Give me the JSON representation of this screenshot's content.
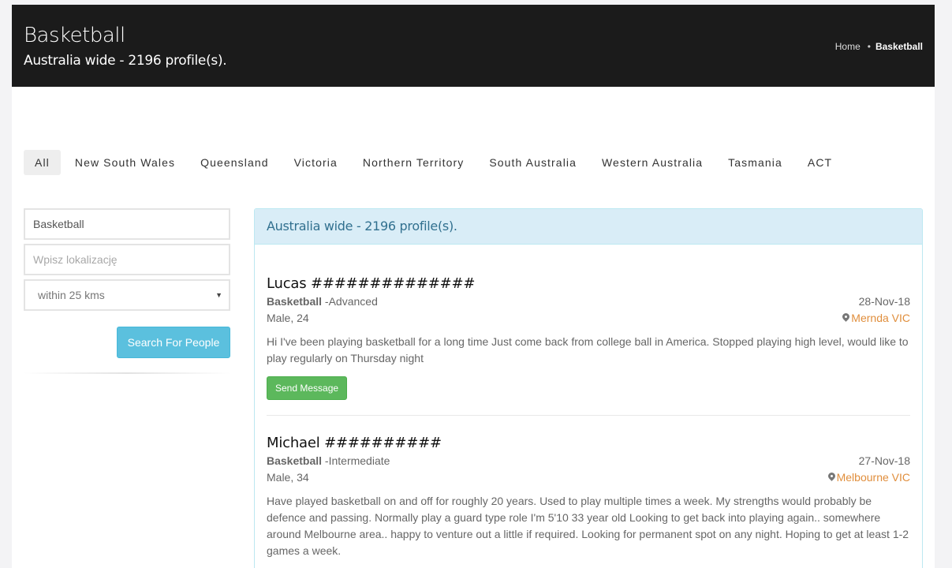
{
  "header": {
    "title": "Basketball",
    "subtitle": "Australia wide - 2196 profile(s).",
    "breadcrumb": {
      "home": "Home",
      "separator": "•",
      "current": "Basketball"
    }
  },
  "tabs": [
    "All",
    "New South Wales",
    "Queensland",
    "Victoria",
    "Northern Territory",
    "South Australia",
    "Western Australia",
    "Tasmania",
    "ACT"
  ],
  "search": {
    "activity_value": "Basketball",
    "location_placeholder": "Wpisz lokalizację",
    "distance_selected": "within 25 kms",
    "button_label": "Search For People"
  },
  "results": {
    "heading": "Australia wide - 2196 profile(s).",
    "profiles": [
      {
        "name": "Lucas ##############",
        "sport": "Basketball",
        "level": " -Advanced",
        "gender_age": "Male, 24",
        "date": "28-Nov-18",
        "location": "Mernda VIC",
        "description": "Hi I've been playing basketball for a long time Just come back from college ball in America. Stopped playing high level, would like to play regularly on Thursday night",
        "button": "Send Message"
      },
      {
        "name": "Michael ##########",
        "sport": "Basketball",
        "level": " -Intermediate",
        "gender_age": "Male, 34",
        "date": "27-Nov-18",
        "location": "Melbourne VIC",
        "description": "Have played basketball on and off for roughly 20 years. Used to play multiple times a week. My strengths would probably be defence and passing. Normally play a guard type role I'm 5'10 33 year old Looking to get back into playing again.. somewhere around Melbourne area.. happy to venture out a little if required. Looking for permanent spot on any night. Hoping to get at least 1-2 games a week."
      }
    ]
  },
  "colors": {
    "header_bg": "#1b1b1b",
    "panel_heading_bg": "#d9edf7",
    "search_button": "#5bc0de",
    "send_button": "#5cb85c",
    "location_link": "#e08e3c"
  },
  "icons": {
    "location": "map-marker-icon",
    "select": "caret-down-icon"
  }
}
